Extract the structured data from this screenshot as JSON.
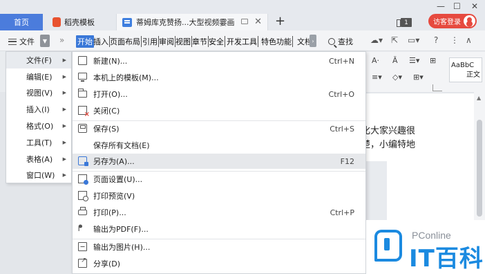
{
  "tabs": {
    "home": "首页",
    "daoke": "稻壳模板",
    "doc_title": "蒂姆库克赞扬...大型视频霎画"
  },
  "window": {
    "badge_count": "1",
    "visitor_login": "访客登录"
  },
  "ribbon": {
    "menu_label": "文件",
    "tabs": [
      "开始",
      "插入",
      "页面布局",
      "引用",
      "审阅",
      "视图",
      "章节",
      "安全",
      "开发工具",
      "特色功能",
      "文档"
    ],
    "active_tab": "开始",
    "search_label": "查找"
  },
  "toolbar_right": {
    "style_preview": "AaBbC",
    "style_name": "正文"
  },
  "left_menu": {
    "items": [
      {
        "label": "文件(F)"
      },
      {
        "label": "编辑(E)"
      },
      {
        "label": "视图(V)"
      },
      {
        "label": "插入(I)"
      },
      {
        "label": "格式(O)"
      },
      {
        "label": "工具(T)"
      },
      {
        "label": "表格(A)"
      },
      {
        "label": "窗口(W)"
      }
    ],
    "active_index": 0
  },
  "file_menu": {
    "items": [
      {
        "label": "新建(N)...",
        "shortcut": "Ctrl+N",
        "icon": "new-doc-icon"
      },
      {
        "label": "本机上的模板(M)...",
        "shortcut": "",
        "icon": "template-icon"
      },
      {
        "label": "打开(O)...",
        "shortcut": "Ctrl+O",
        "icon": "open-folder-icon"
      },
      {
        "label": "关闭(C)",
        "shortcut": "",
        "icon": "close-doc-icon"
      },
      {
        "label": "保存(S)",
        "shortcut": "Ctrl+S",
        "icon": "save-icon"
      },
      {
        "label": "保存所有文档(E)",
        "shortcut": "",
        "icon": ""
      },
      {
        "label": "另存为(A)...",
        "shortcut": "F12",
        "icon": "save-as-icon"
      },
      {
        "label": "页面设置(U)...",
        "shortcut": "",
        "icon": "page-setup-icon"
      },
      {
        "label": "打印预览(V)",
        "shortcut": "",
        "icon": "print-preview-icon"
      },
      {
        "label": "打印(P)...",
        "shortcut": "Ctrl+P",
        "icon": "printer-icon"
      },
      {
        "label": "输出为PDF(F)...",
        "shortcut": "",
        "icon": "pdf-export-icon"
      },
      {
        "label": "输出为图片(H)...",
        "shortcut": "",
        "icon": "image-export-icon"
      },
      {
        "label": "分享(D)",
        "shortcut": "",
        "icon": "share-icon"
      }
    ],
    "hover_index": 6
  },
  "document": {
    "line1": "化大家兴趣很",
    "line2": "楚，小编特地"
  },
  "watermark": {
    "brand": "PConline",
    "main": "IT百科"
  }
}
